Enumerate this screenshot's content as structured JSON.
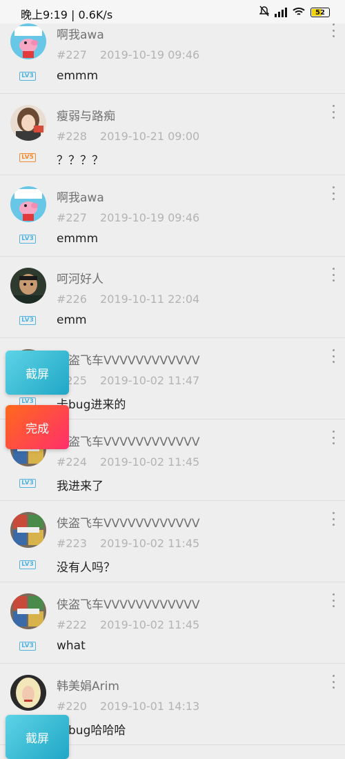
{
  "status_bar": {
    "time_text": "晚上9:19 | 0.6K/s",
    "battery": "52"
  },
  "comments": [
    {
      "name": "啊我awa",
      "floor": "#227",
      "time": "2019-10-19 09:46",
      "text": "emmm",
      "level": "LV3",
      "level_color": "#4fb3df",
      "avatar": "peppa"
    },
    {
      "name": "瘦弱与路痴",
      "floor": "#228",
      "time": "2019-10-21 09:00",
      "text": "？？？？",
      "level": "LV5",
      "level_color": "#f28a2e",
      "avatar": "girl"
    },
    {
      "name": "啊我awa",
      "floor": "#227",
      "time": "2019-10-19 09:46",
      "text": "emmm",
      "level": "LV3",
      "level_color": "#4fb3df",
      "avatar": "peppa"
    },
    {
      "name": "呵河好人",
      "floor": "#226",
      "time": "2019-10-11 22:04",
      "text": "emm",
      "level": "LV3",
      "level_color": "#4fb3df",
      "avatar": "man"
    },
    {
      "name": "侠盗飞车VVVVVVVVVVVV",
      "floor": "#225",
      "time": "2019-10-02 11:47",
      "text": "卡bug进来的",
      "level": "LV3",
      "level_color": "#4fb3df",
      "avatar": "gta"
    },
    {
      "name": "侠盗飞车VVVVVVVVVVVV",
      "floor": "#224",
      "time": "2019-10-02 11:45",
      "text": "我进来了",
      "level": "LV3",
      "level_color": "#4fb3df",
      "avatar": "gta"
    },
    {
      "name": "侠盗飞车VVVVVVVVVVVV",
      "floor": "#223",
      "time": "2019-10-02 11:45",
      "text": "没有人吗？",
      "level": "LV3",
      "level_color": "#4fb3df",
      "avatar": "gta"
    },
    {
      "name": "侠盗飞车VVVVVVVVVVVV",
      "floor": "#222",
      "time": "2019-10-02 11:45",
      "text": "what",
      "level": "LV3",
      "level_color": "#4fb3df",
      "avatar": "gta"
    },
    {
      "name": "韩美娟Arim",
      "floor": "#220",
      "time": "2019-10-01 14:13",
      "text": "卡bug哈哈哈",
      "level": "LV3",
      "level_color": "#4fb3df",
      "avatar": "blonde"
    }
  ],
  "floating_buttons": {
    "capture_label": "截屏",
    "done_label": "完成"
  }
}
